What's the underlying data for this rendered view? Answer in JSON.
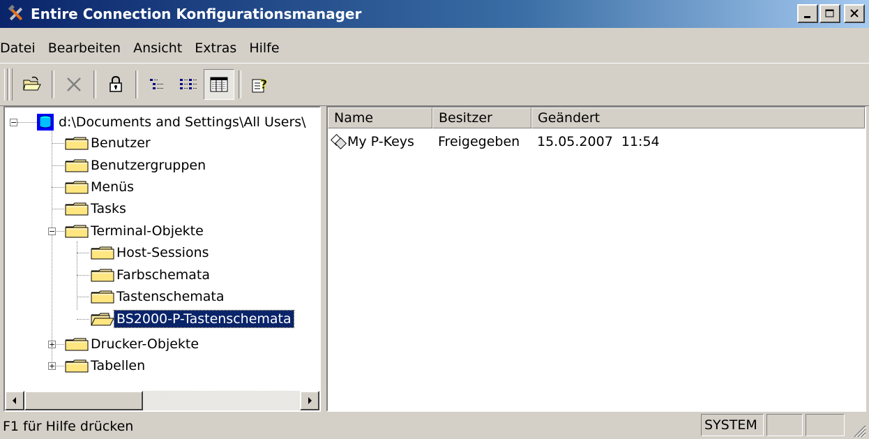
{
  "window": {
    "title": "Entire Connection Konfigurationsmanager"
  },
  "menu": [
    "Datei",
    "Bearbeiten",
    "Ansicht",
    "Extras",
    "Hilfe"
  ],
  "toolbar": [
    {
      "icon": "open-folder-icon"
    },
    {
      "icon": "delete-icon"
    },
    {
      "icon": "lock-icon"
    },
    {
      "icon": "list-view-icon"
    },
    {
      "icon": "details-view-icon"
    },
    {
      "icon": "report-view-icon",
      "active": true
    },
    {
      "icon": "help-icon"
    }
  ],
  "tree": {
    "root": "d:\\Documents and Settings\\All Users\\",
    "items": [
      {
        "label": "Benutzer"
      },
      {
        "label": "Benutzergruppen"
      },
      {
        "label": "Menüs"
      },
      {
        "label": "Tasks"
      },
      {
        "label": "Terminal-Objekte",
        "expanded": true,
        "children": [
          {
            "label": "Host-Sessions"
          },
          {
            "label": "Farbschemata"
          },
          {
            "label": "Tastenschemata"
          },
          {
            "label": "BS2000-P-Tastenschemata",
            "selected": true
          }
        ]
      },
      {
        "label": "Drucker-Objekte",
        "collapsed": true
      },
      {
        "label": "Tabellen",
        "collapsed": true
      }
    ]
  },
  "list": {
    "columns": [
      "Name",
      "Besitzer",
      "Geändert"
    ],
    "rows": [
      {
        "name": "My P-Keys",
        "owner": "Freigegeben",
        "modified": "15.05.2007  11:54",
        "icon": "keys-icon"
      }
    ]
  },
  "status": {
    "text": "F1 für Hilfe drücken",
    "panels": [
      "SYSTEM",
      "",
      ""
    ]
  }
}
